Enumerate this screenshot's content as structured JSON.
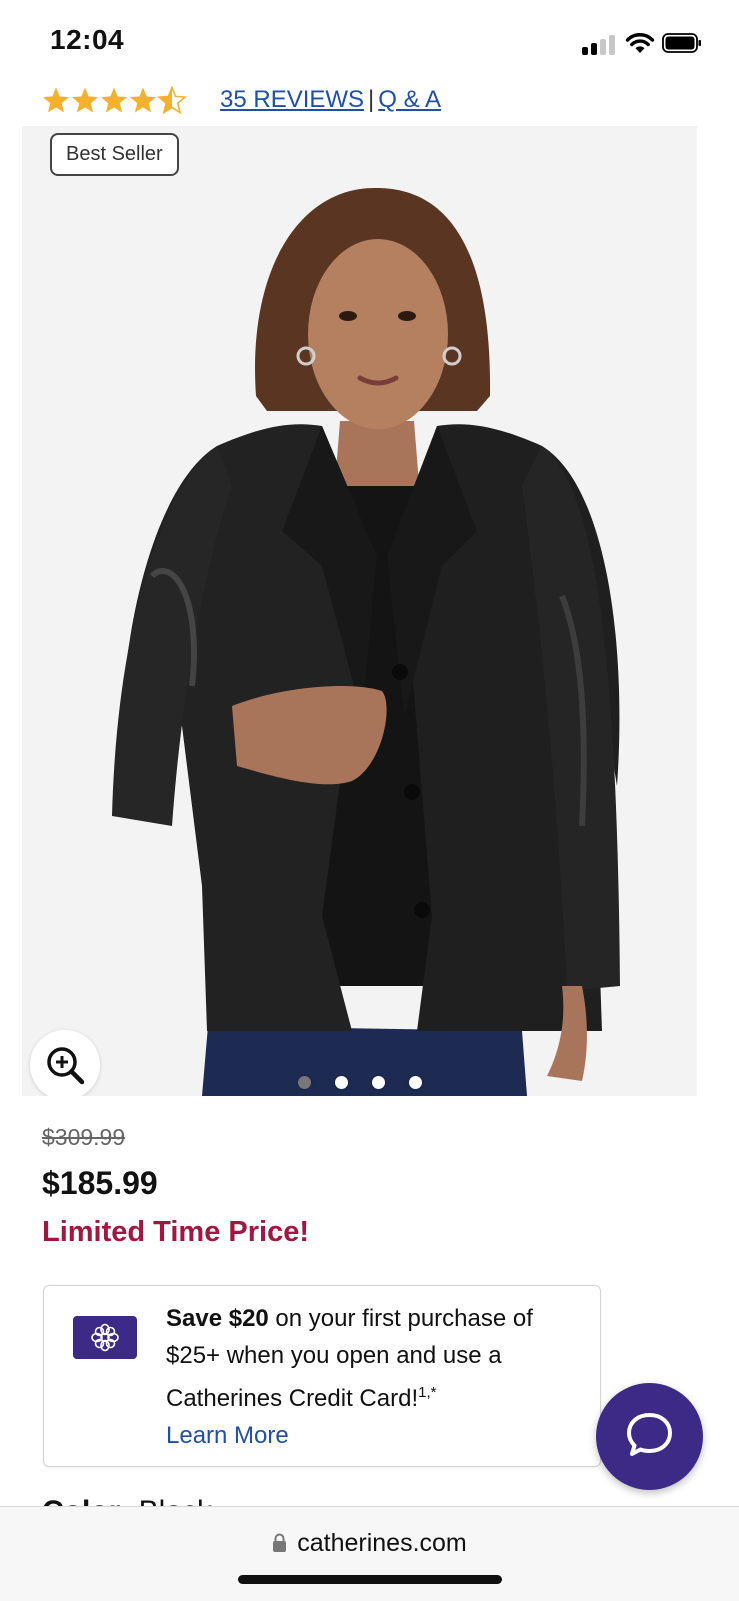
{
  "status_bar": {
    "time": "12:04"
  },
  "rating": {
    "value": 4.5,
    "max": 5,
    "star_color": "#f6b12c"
  },
  "reviews": {
    "reviews_link": "35 REVIEWS",
    "separator": "|",
    "qa_link": "Q & A"
  },
  "product_image": {
    "badge": "Best Seller",
    "slide_count": 4,
    "active_slide": 1
  },
  "price": {
    "original": "$309.99",
    "sale": "$185.99",
    "promo": "Limited Time Price!"
  },
  "credit_promo": {
    "bold": "Save $20",
    "text": " on your first purchase of $25+ when you open and use a Catherines Credit Card!",
    "superscript": "1,*",
    "learn_more": "Learn More"
  },
  "color_peek": {
    "label": "Color:",
    "value": " Black"
  },
  "browser": {
    "url": "catherines.com"
  },
  "colors": {
    "brand_purple": "#3d2a86",
    "link_blue": "#1f4fa8",
    "promo_red": "#a1173f"
  }
}
